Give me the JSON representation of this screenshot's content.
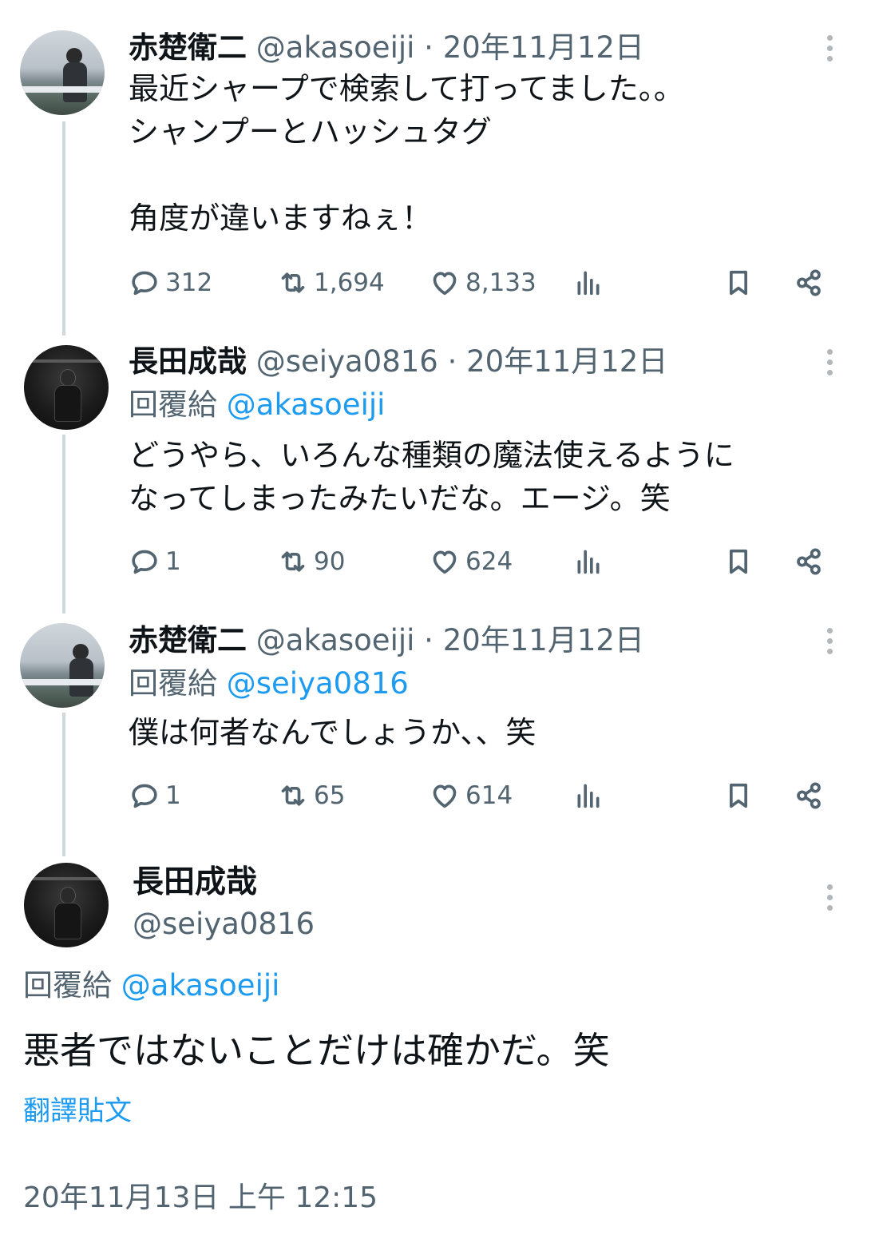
{
  "tweets": [
    {
      "name": "赤楚衛二",
      "handle_meta": "@akasoeiji · 20年11月12日",
      "reply_to": null,
      "text": "最近シャープで検索して打ってました。。\nシャンプーとハッシュタグ\n\n角度が違いますねぇ！",
      "replies": "312",
      "retweets": "1,694",
      "likes": "8,133",
      "avatar": "landscape"
    },
    {
      "name": "長田成哉",
      "handle_meta": "@seiya0816 · 20年11月12日",
      "reply_to": {
        "label": "回覆給",
        "mention": "@akasoeiji"
      },
      "text": "どうやら、いろんな種類の魔法使えるように\nなってしまったみたいだな。エージ。笑",
      "replies": "1",
      "retweets": "90",
      "likes": "624",
      "avatar": "dark"
    },
    {
      "name": "赤楚衛二",
      "handle_meta": "@akasoeiji · 20年11月12日",
      "reply_to": {
        "label": "回覆給",
        "mention": "@seiya0816"
      },
      "text": "僕は何者なんでしょうか、、笑",
      "replies": "1",
      "retweets": "65",
      "likes": "614",
      "avatar": "landscape"
    }
  ],
  "main_tweet": {
    "name": "長田成哉",
    "handle": "@seiya0816",
    "reply_label": "回覆給",
    "reply_mention": "@akasoeiji",
    "text": "悪者ではないことだけは確かだ。笑",
    "translate_label": "翻譯貼文",
    "timestamp": "20年11月13日 上午 12:15"
  },
  "colors": {
    "text": "#0f1419",
    "secondary": "#536471",
    "link": "#1d9bf0",
    "thread_line": "#cfd9de"
  },
  "icons": {
    "reply": "reply-icon",
    "retweet": "retweet-icon",
    "like": "heart-icon",
    "views": "views-icon",
    "bookmark": "bookmark-icon",
    "share": "share-icon",
    "more": "more-icon"
  }
}
